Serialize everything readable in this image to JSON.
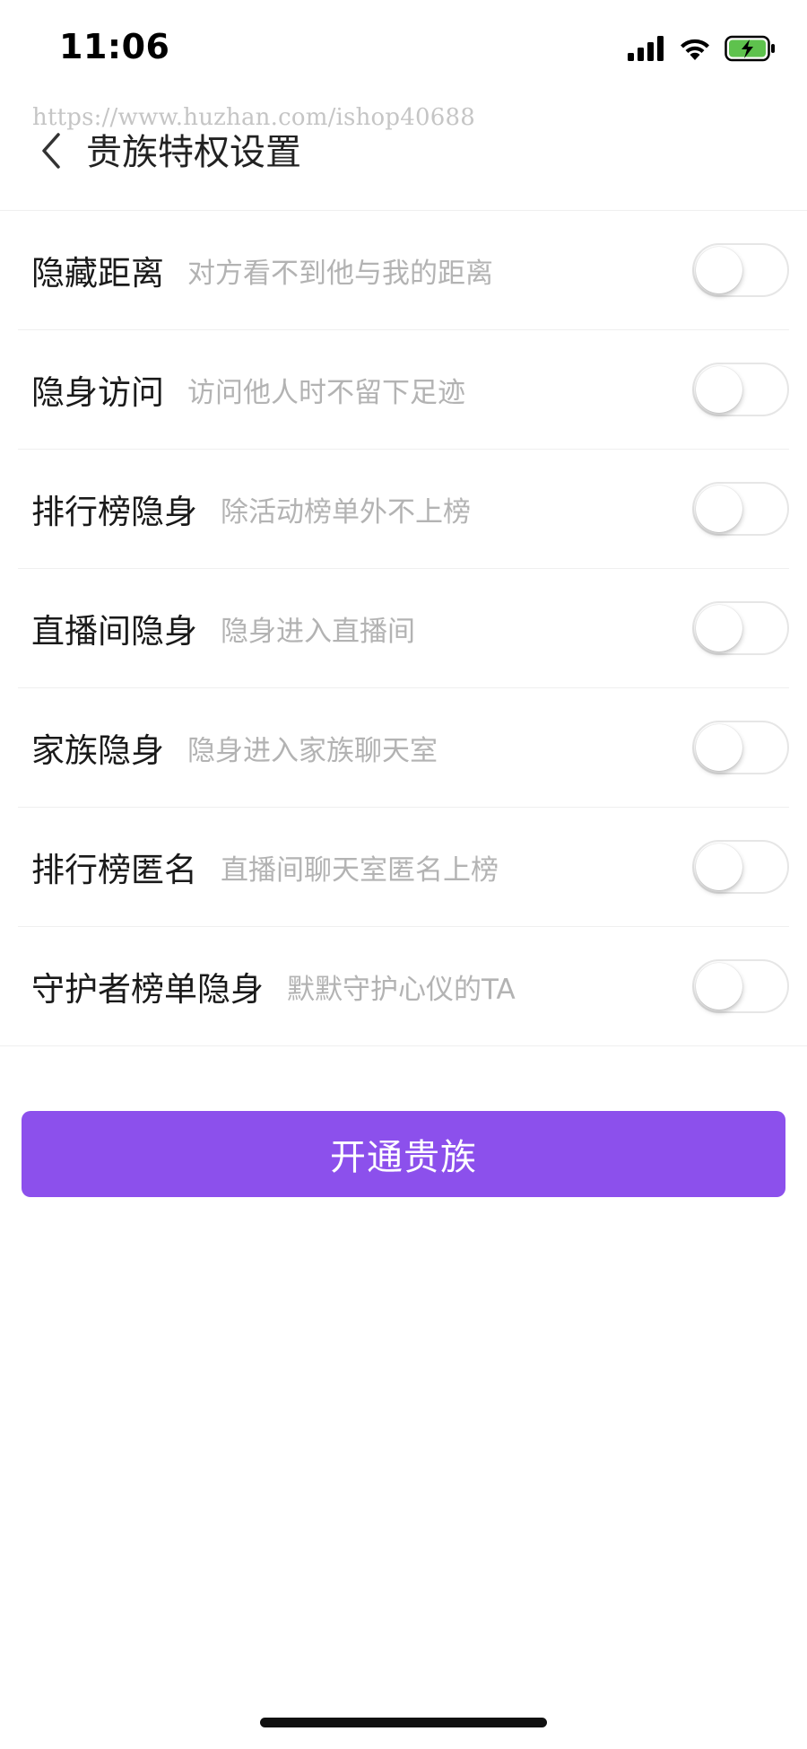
{
  "status_bar": {
    "time": "11:06",
    "icons": [
      "signal-icon",
      "wifi-icon",
      "battery-charging-icon"
    ],
    "battery_color": "#5ec24d"
  },
  "watermark": "https://www.huzhan.com/ishop40688",
  "nav": {
    "title": "贵族特权设置",
    "back_icon": "chevron-left-icon"
  },
  "settings": [
    {
      "title": "隐藏距离",
      "desc": "对方看不到他与我的距离",
      "enabled": false
    },
    {
      "title": "隐身访问",
      "desc": "访问他人时不留下足迹",
      "enabled": false
    },
    {
      "title": "排行榜隐身",
      "desc": "除活动榜单外不上榜",
      "enabled": false
    },
    {
      "title": "直播间隐身",
      "desc": "隐身进入直播间",
      "enabled": false
    },
    {
      "title": "家族隐身",
      "desc": "隐身进入家族聊天室",
      "enabled": false
    },
    {
      "title": "排行榜匿名",
      "desc": "直播间聊天室匿名上榜",
      "enabled": false
    },
    {
      "title": "守护者榜单隐身",
      "desc": "默默守护心仪的TA",
      "enabled": false
    }
  ],
  "primary_button": {
    "label": "开通贵族",
    "color": "#8c50ec"
  }
}
